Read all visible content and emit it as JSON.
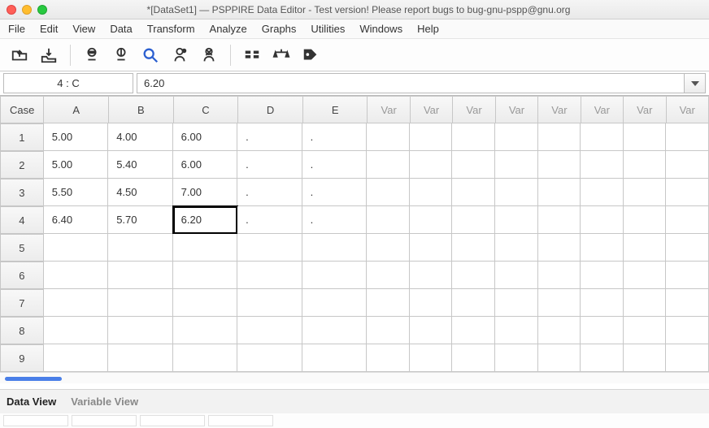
{
  "window": {
    "title": "*[DataSet1] — PSPPIRE Data Editor - Test version! Please report bugs to bug-gnu-pspp@gnu.org"
  },
  "menus": [
    "File",
    "Edit",
    "View",
    "Data",
    "Transform",
    "Analyze",
    "Graphs",
    "Utilities",
    "Windows",
    "Help"
  ],
  "toolbar_icons": [
    "open",
    "save",
    "goto-case",
    "goto-var",
    "search",
    "insert-case",
    "insert-var",
    "split",
    "weight",
    "labels"
  ],
  "cellref": {
    "label": "4 : C",
    "value": "6.20"
  },
  "columns": {
    "case": "Case",
    "named": [
      "A",
      "B",
      "C",
      "D",
      "E"
    ],
    "var_placeholder": "Var",
    "var_count": 8
  },
  "rows_shown": 9,
  "data": [
    {
      "case": "1",
      "A": "5.00",
      "B": "4.00",
      "C": "6.00",
      "D": ".",
      "E": "."
    },
    {
      "case": "2",
      "A": "5.00",
      "B": "5.40",
      "C": "6.00",
      "D": ".",
      "E": "."
    },
    {
      "case": "3",
      "A": "5.50",
      "B": "4.50",
      "C": "7.00",
      "D": ".",
      "E": "."
    },
    {
      "case": "4",
      "A": "6.40",
      "B": "5.70",
      "C": "6.20",
      "D": ".",
      "E": "."
    }
  ],
  "selected": {
    "row": 4,
    "col": "C"
  },
  "tabs": {
    "data_view": "Data View",
    "variable_view": "Variable View",
    "active": "data_view"
  }
}
